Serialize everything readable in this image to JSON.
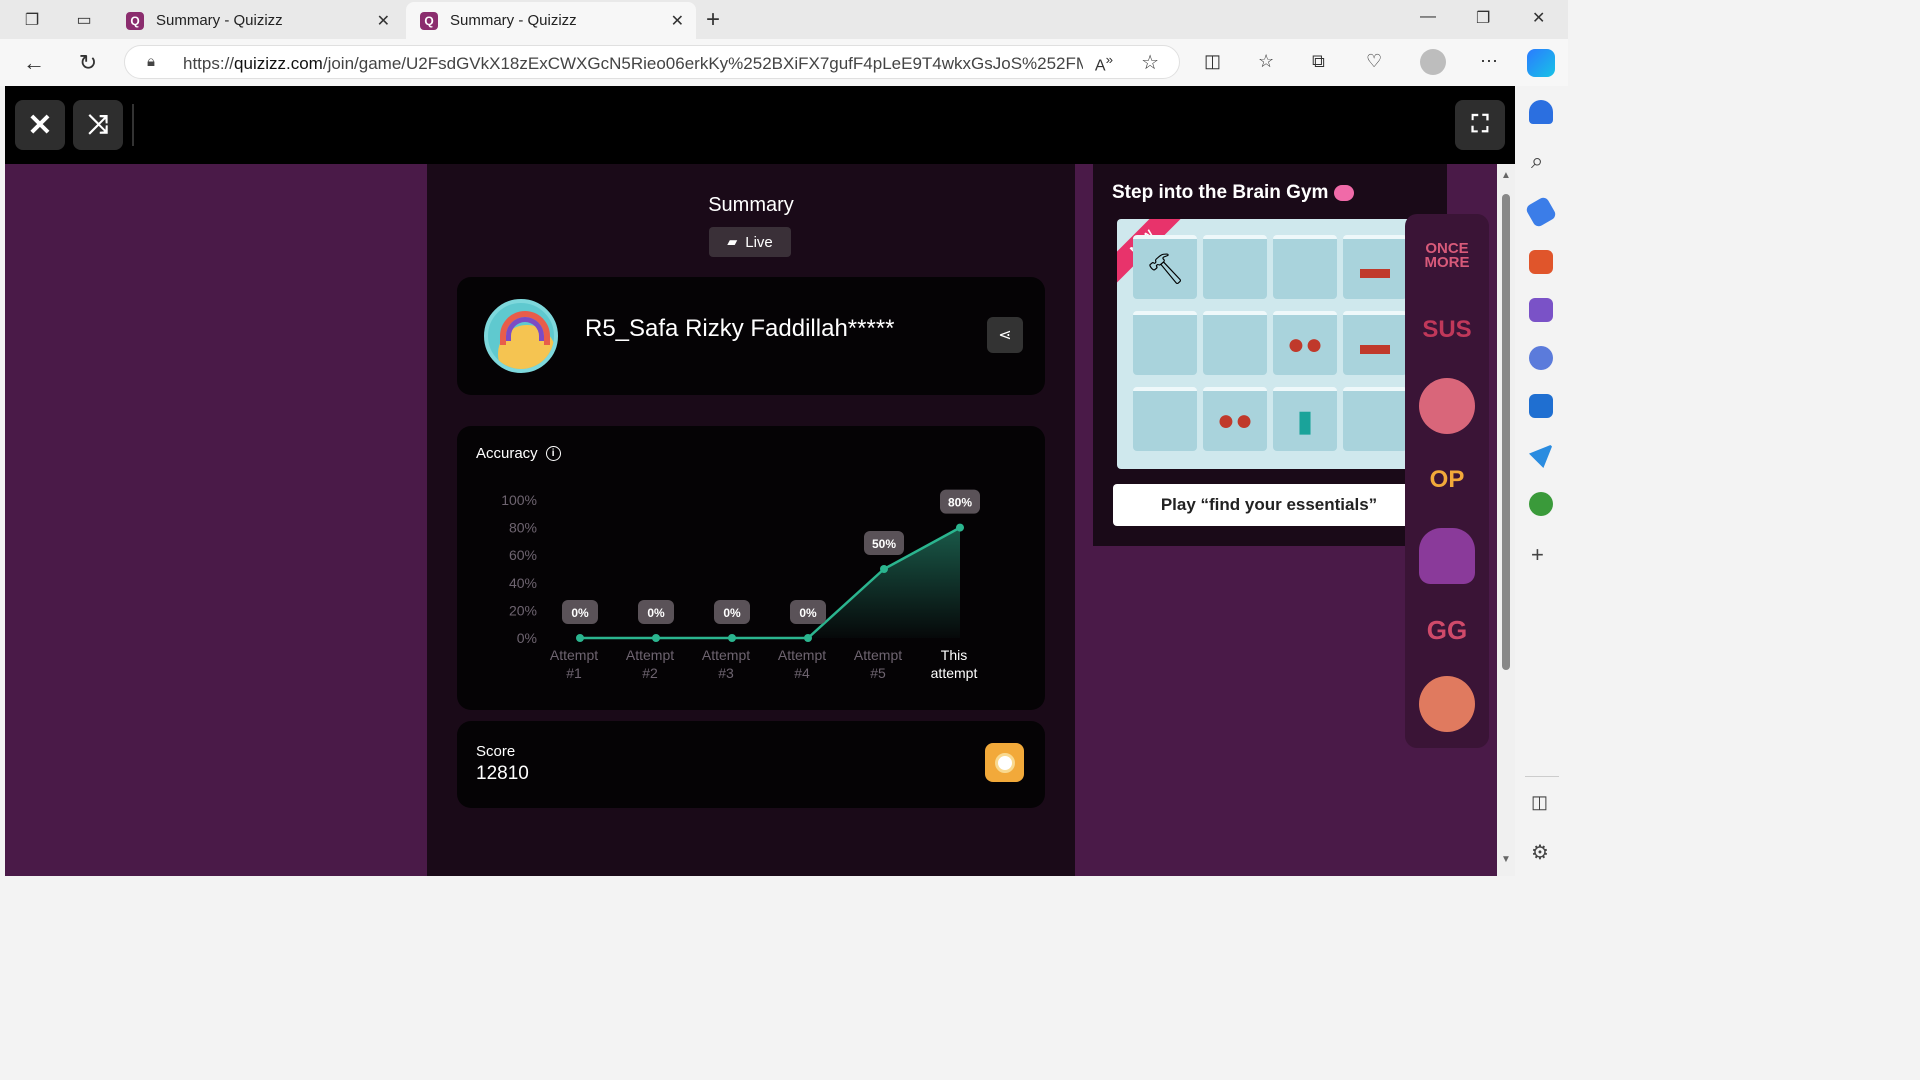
{
  "browser": {
    "tabs": [
      {
        "title": "Summary - Quizizz",
        "favicon": "Q"
      },
      {
        "title": "Summary - Quizizz",
        "favicon": "Q"
      }
    ],
    "url_prefix": "https://",
    "url_domain": "quizizz.com",
    "url_rest": "/join/game/U2FsdGVkX18zExCWXGcN5Rieo06erkKy%252BXiFX7gufF4pLeE9T4wkxGsJoS%252FM..."
  },
  "page": {
    "summary_title": "Summary",
    "live_label": "Live",
    "player_name": "R5_Safa Rizky Faddillah*****",
    "accuracy_label": "Accuracy",
    "score_label": "Score",
    "score_value": "12810"
  },
  "brain_gym": {
    "title": "Step into the Brain Gym",
    "new_label": "NEW",
    "play_button": "Play “find your essentials”"
  },
  "stickers": [
    "ONCE MORE",
    "SUS",
    "",
    "OP",
    "",
    "GG",
    ""
  ],
  "colors": {
    "page_bg": "#4a1a48",
    "panel_bg": "#1a0a18",
    "accent_line": "#2bb58f",
    "coin": "#f2a93a"
  },
  "chart_data": {
    "type": "line",
    "title": "Accuracy",
    "categories": [
      "Attempt #1",
      "Attempt #2",
      "Attempt #3",
      "Attempt #4",
      "Attempt #5",
      "This attempt"
    ],
    "category_lines": [
      [
        "Attempt",
        "#1"
      ],
      [
        "Attempt",
        "#2"
      ],
      [
        "Attempt",
        "#3"
      ],
      [
        "Attempt",
        "#4"
      ],
      [
        "Attempt",
        "#5"
      ],
      [
        "This",
        "attempt"
      ]
    ],
    "values": [
      0,
      0,
      0,
      0,
      50,
      80
    ],
    "point_labels": [
      "0%",
      "0%",
      "0%",
      "0%",
      "50%",
      "80%"
    ],
    "y_ticks": [
      "0%",
      "20%",
      "40%",
      "60%",
      "80%",
      "100%"
    ],
    "ylim": [
      0,
      100
    ],
    "grid": false
  }
}
